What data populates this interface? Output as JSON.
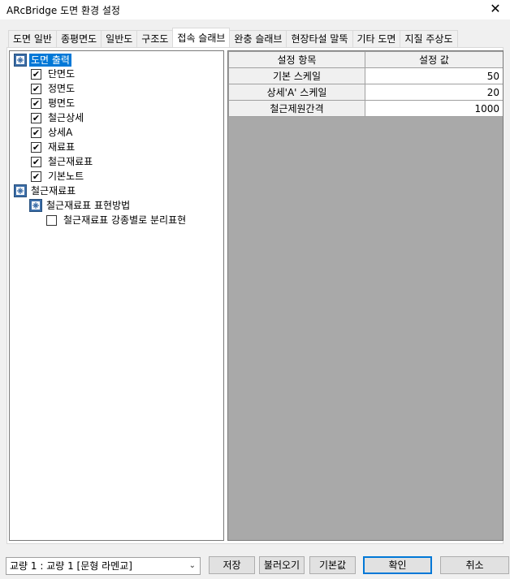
{
  "window": {
    "title": "ARcBridge 도면 환경 설정",
    "close_glyph": "✕"
  },
  "tabs": [
    {
      "label": "도면 일반"
    },
    {
      "label": "종평면도"
    },
    {
      "label": "일반도"
    },
    {
      "label": "구조도"
    },
    {
      "label": "접속 슬래브",
      "active": true
    },
    {
      "label": "완충 슬래브"
    },
    {
      "label": "현장타설 말뚝"
    },
    {
      "label": "기타 도면"
    },
    {
      "label": "지질 주상도"
    }
  ],
  "tree": {
    "group1": {
      "label": "도면 출력",
      "icon": "settings-group-icon",
      "selected": true
    },
    "items": [
      {
        "label": "단면도",
        "checked": true
      },
      {
        "label": "정면도",
        "checked": true
      },
      {
        "label": "평면도",
        "checked": true
      },
      {
        "label": "철근상세",
        "checked": true
      },
      {
        "label": "상세A",
        "checked": true
      },
      {
        "label": "재료표",
        "checked": true
      },
      {
        "label": "철근재료표",
        "checked": true
      },
      {
        "label": "기본노트",
        "checked": true
      }
    ],
    "group2": {
      "label": "철근재료표",
      "icon": "settings-group-icon"
    },
    "subgroup": {
      "label": "철근재료표 표현방법",
      "icon": "settings-group-icon"
    },
    "subitem": {
      "label": "철근재료표 강종별로 분리표현",
      "checked": false
    },
    "check_glyph": "✔"
  },
  "grid": {
    "headers": {
      "key": "설정 항목",
      "value": "설정 값"
    },
    "rows": [
      {
        "key": "기본 스케일",
        "value": "50"
      },
      {
        "key": "상세'A' 스케일",
        "value": "20"
      },
      {
        "key": "철근제원간격",
        "value": "1000"
      }
    ]
  },
  "footer": {
    "bridge_select": "교량 1 : 교량 1 [문형 라멘교]",
    "save_label": "저장",
    "load_label": "불러오기",
    "default_label": "기본값",
    "ok_label": "확인",
    "cancel_label": "취소"
  },
  "colors": {
    "selection": "#0078d7",
    "grid_empty": "#a9a9a9",
    "accent": "#0078d7"
  }
}
